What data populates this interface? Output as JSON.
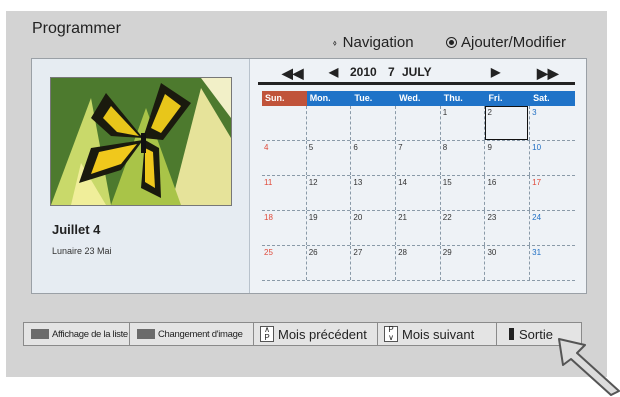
{
  "header": {
    "title": "Programmer",
    "nav_label": "Navigation",
    "mode_label": "Ajouter/Modifier"
  },
  "photo_panel": {
    "date_title": "Juillet 4",
    "lunar_date": "Lunaire 23 Mai"
  },
  "calendar": {
    "year": "2010",
    "day": "7",
    "month": "JULY",
    "weekdays": [
      "Sun.",
      "Mon.",
      "Tue.",
      "Wed.",
      "Thu.",
      "Fri.",
      "Sat."
    ],
    "weeks": [
      [
        "",
        "",
        "",
        "",
        "1",
        "2",
        "3"
      ],
      [
        "4",
        "5",
        "6",
        "7",
        "8",
        "9",
        "10"
      ],
      [
        "11",
        "12",
        "13",
        "14",
        "15",
        "16",
        "17"
      ],
      [
        "18",
        "19",
        "20",
        "21",
        "22",
        "23",
        "24"
      ],
      [
        "25",
        "26",
        "27",
        "28",
        "29",
        "30",
        "31"
      ]
    ],
    "selected_day": "2",
    "colors": {
      "sunday_header": "#c0533a",
      "weekday_header": "#1f73c8",
      "sunday_text": "#e04a3a",
      "saturday_text": "#1f6fc4"
    }
  },
  "buttons": {
    "list_view": "Affichage de la liste",
    "change_image": "Changement d'image",
    "prev_month": "Mois précédent",
    "next_month": "Mois suivant",
    "exit": "Sortie",
    "p_key": "P"
  }
}
